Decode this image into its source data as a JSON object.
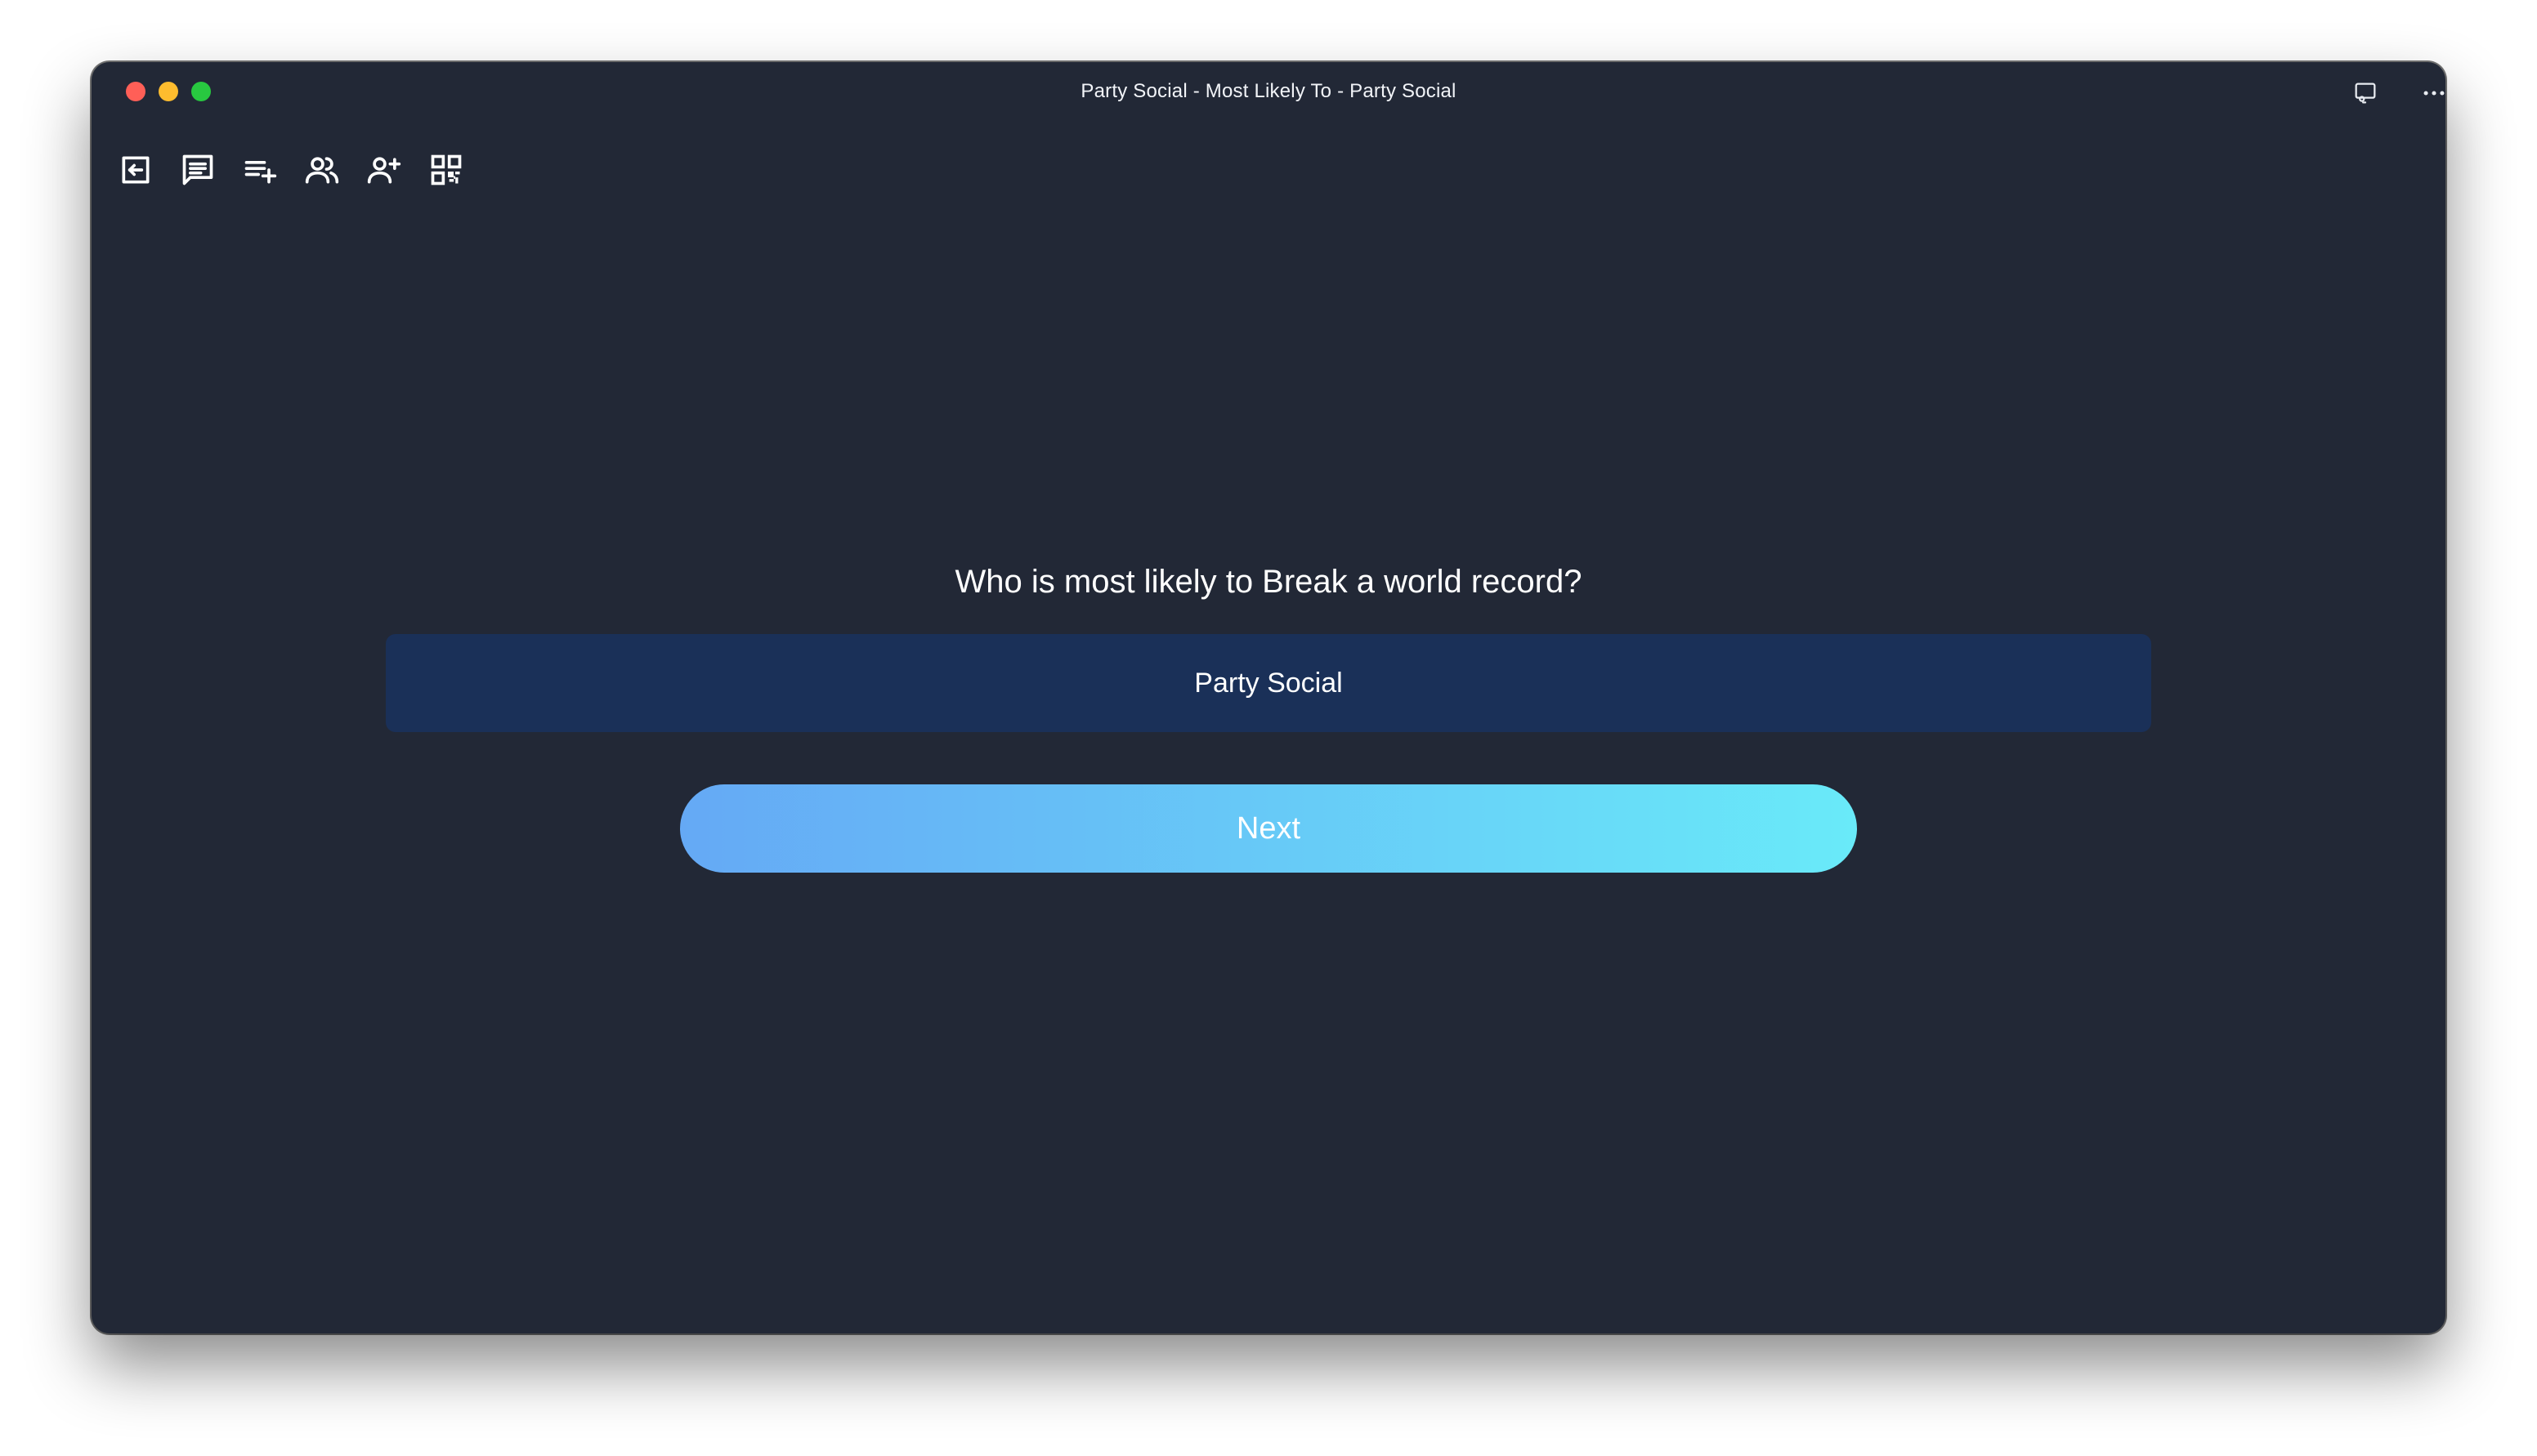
{
  "window": {
    "title": "Party Social - Most Likely To - Party Social"
  },
  "colors": {
    "background": "#222836",
    "answer_box": "#1a3058",
    "button_gradient_start": "#65a9f5",
    "button_gradient_end": "#69eaf9",
    "close": "#ff5f57",
    "minimize": "#febc2e",
    "maximize": "#28c840"
  },
  "toolbar": {
    "items": [
      {
        "icon": "exit-icon"
      },
      {
        "icon": "chat-icon"
      },
      {
        "icon": "playlist-add-icon"
      },
      {
        "icon": "group-icon"
      },
      {
        "icon": "add-person-icon"
      },
      {
        "icon": "qr-code-icon"
      }
    ]
  },
  "titlebar_actions": [
    {
      "icon": "cast-screen-icon"
    },
    {
      "icon": "more-icon"
    }
  ],
  "game": {
    "question": "Who is most likely to Break a world record?",
    "answer": "Party Social",
    "next_label": "Next"
  }
}
